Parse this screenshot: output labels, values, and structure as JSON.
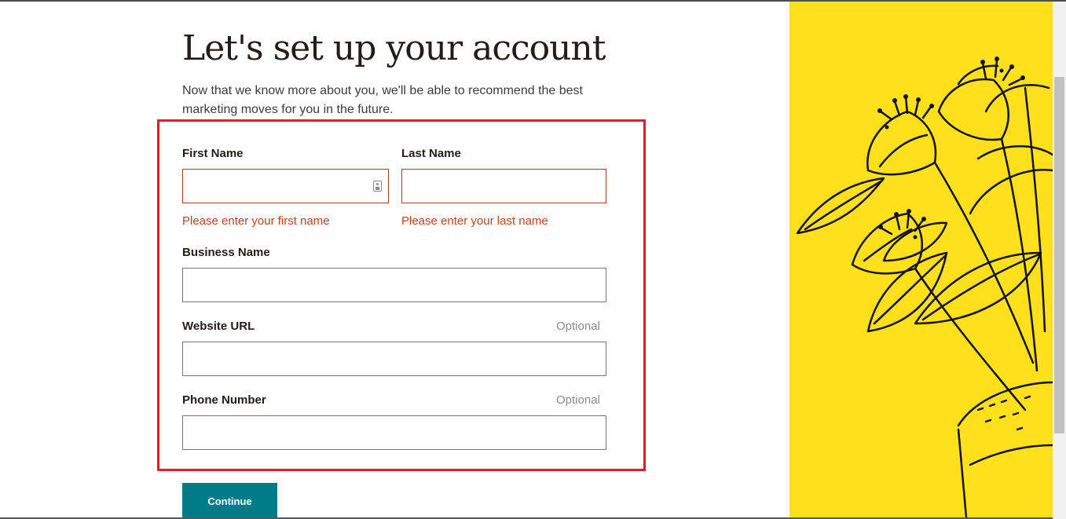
{
  "page": {
    "title": "Let's set up your account",
    "subtitle": "Now that we know more about you, we'll be able to recommend the best marketing moves for you in the future."
  },
  "form": {
    "first_name": {
      "label": "First Name",
      "value": "",
      "error": "Please enter your first name"
    },
    "last_name": {
      "label": "Last Name",
      "value": "",
      "error": "Please enter your last name"
    },
    "business_name": {
      "label": "Business Name",
      "value": ""
    },
    "website_url": {
      "label": "Website URL",
      "optional": "Optional",
      "value": ""
    },
    "phone_number": {
      "label": "Phone Number",
      "optional": "Optional",
      "value": ""
    },
    "continue_label": "Continue"
  },
  "colors": {
    "accent_button": "#007c89",
    "error": "#b7461e",
    "highlight_box": "#e01e2b",
    "illustration_bg": "#ffe01b"
  }
}
